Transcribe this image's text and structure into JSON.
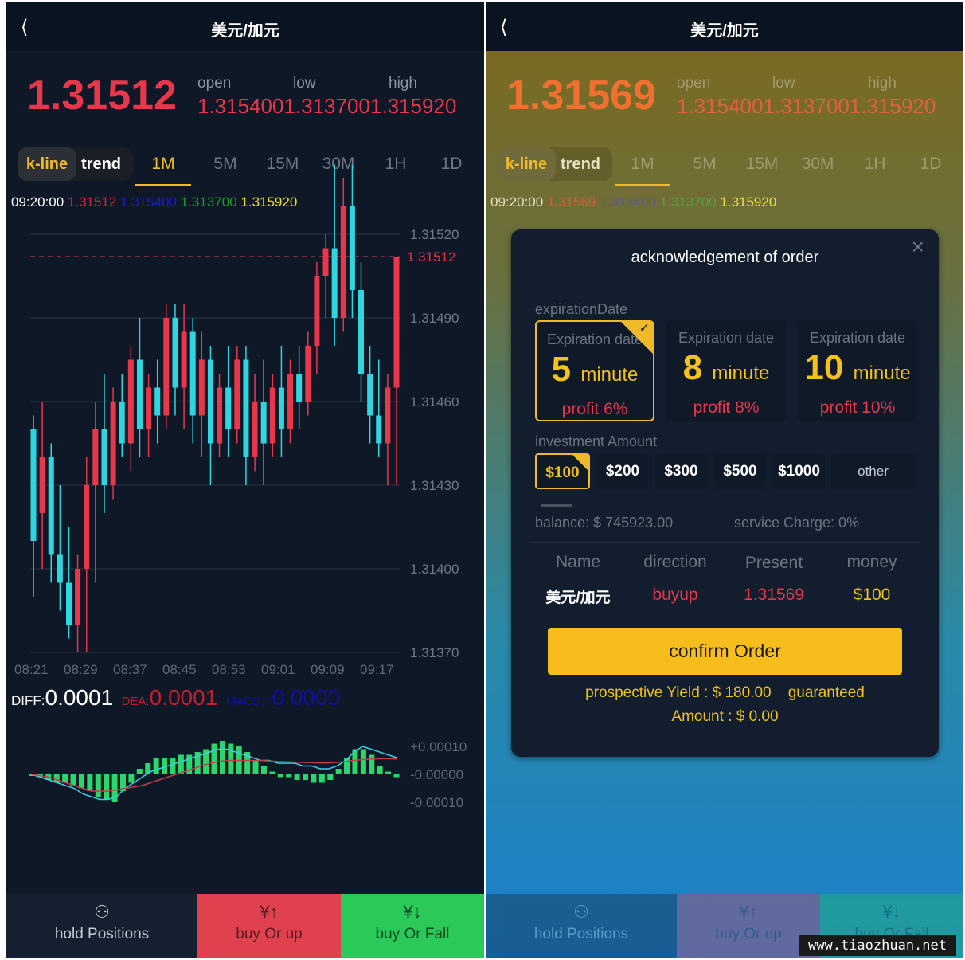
{
  "colors": {
    "up": "#e8374b",
    "down": "#2fd6e0",
    "accent": "#f0b92a",
    "buy_up": "#e0414f",
    "buy_fall": "#2bc95a",
    "macd_bar": "#2bd66a"
  },
  "left": {
    "title": "美元/加元",
    "back_icon": "chevron-left-icon",
    "price": "1.31512",
    "labels": {
      "open": "open",
      "low": "low",
      "high": "high"
    },
    "values_joined": "1.3154001.3137001.315920",
    "tabs": {
      "kline": "k-line",
      "trend": "trend",
      "timeframes": [
        "1M",
        "5M",
        "15M",
        "30M",
        "1H",
        "1D"
      ],
      "active": "1M"
    },
    "ohlc": {
      "time": "09:20:00",
      "close": "1.31512",
      "open": "1.315400",
      "low": "1.313700",
      "high": "1.315920"
    },
    "macd": {
      "diff_label": "DIFF:",
      "diff": "0.0001",
      "dea_label": "DEA:",
      "dea": "0.0001",
      "macd_label": "MACD:",
      "macd": "-0.0000"
    },
    "bottom": {
      "hold": "hold Positions",
      "up": "buy Or up",
      "fall": "buy Or Fall"
    }
  },
  "chart_data": {
    "type": "candlestick",
    "y_ticks": [
      "1.31520",
      "1.31490",
      "1.31460",
      "1.31430",
      "1.31400",
      "1.31370"
    ],
    "ylim": [
      1.3137,
      1.3152
    ],
    "current_price_label": "1.31512",
    "x_ticks": [
      "08:21",
      "08:29",
      "08:37",
      "08:45",
      "08:53",
      "09:01",
      "09:09",
      "09:17"
    ],
    "candles": [
      [
        1.3145,
        1.31455,
        1.3139,
        1.3141
      ],
      [
        1.3142,
        1.3146,
        1.314,
        1.3144
      ],
      [
        1.3144,
        1.31445,
        1.31395,
        1.31405
      ],
      [
        1.31405,
        1.3143,
        1.31385,
        1.31395
      ],
      [
        1.31395,
        1.31415,
        1.31375,
        1.3138
      ],
      [
        1.3138,
        1.31405,
        1.3137,
        1.314
      ],
      [
        1.314,
        1.3144,
        1.3137,
        1.3143
      ],
      [
        1.3143,
        1.3146,
        1.31395,
        1.3145
      ],
      [
        1.3145,
        1.3147,
        1.3142,
        1.3143
      ],
      [
        1.3143,
        1.31465,
        1.31425,
        1.3146
      ],
      [
        1.3146,
        1.3147,
        1.3144,
        1.31445
      ],
      [
        1.31445,
        1.3148,
        1.31435,
        1.31475
      ],
      [
        1.31475,
        1.3149,
        1.3144,
        1.3145
      ],
      [
        1.3145,
        1.3147,
        1.3144,
        1.31465
      ],
      [
        1.31465,
        1.31475,
        1.31445,
        1.31455
      ],
      [
        1.31455,
        1.31495,
        1.3145,
        1.3149
      ],
      [
        1.3149,
        1.31495,
        1.31455,
        1.31465
      ],
      [
        1.31465,
        1.31495,
        1.3145,
        1.31485
      ],
      [
        1.31485,
        1.3149,
        1.31445,
        1.31455
      ],
      [
        1.31455,
        1.31485,
        1.3144,
        1.31475
      ],
      [
        1.31475,
        1.3148,
        1.3143,
        1.31445
      ],
      [
        1.31445,
        1.3147,
        1.3144,
        1.31465
      ],
      [
        1.31465,
        1.3148,
        1.3144,
        1.3145
      ],
      [
        1.3145,
        1.3148,
        1.31445,
        1.31475
      ],
      [
        1.31475,
        1.3148,
        1.3143,
        1.3144
      ],
      [
        1.3144,
        1.3147,
        1.31435,
        1.3146
      ],
      [
        1.3146,
        1.31475,
        1.3143,
        1.31445
      ],
      [
        1.31445,
        1.3147,
        1.3144,
        1.31465
      ],
      [
        1.31465,
        1.3148,
        1.3144,
        1.3145
      ],
      [
        1.3145,
        1.31475,
        1.31445,
        1.3147
      ],
      [
        1.3147,
        1.3148,
        1.3145,
        1.3146
      ],
      [
        1.3146,
        1.31485,
        1.31455,
        1.3148
      ],
      [
        1.3148,
        1.3151,
        1.3147,
        1.31505
      ],
      [
        1.31505,
        1.3152,
        1.3149,
        1.31515
      ],
      [
        1.31515,
        1.31545,
        1.3148,
        1.3149
      ],
      [
        1.3149,
        1.3154,
        1.31485,
        1.3153
      ],
      [
        1.3153,
        1.31545,
        1.3149,
        1.315
      ],
      [
        1.315,
        1.3151,
        1.3146,
        1.3147
      ],
      [
        1.3147,
        1.3148,
        1.31445,
        1.31455
      ],
      [
        1.31455,
        1.31475,
        1.3144,
        1.31445
      ],
      [
        1.31445,
        1.3147,
        1.3143,
        1.31465
      ],
      [
        1.31465,
        1.31512,
        1.3143,
        1.31512
      ]
    ],
    "macd_ticks": [
      "+0.00010",
      "-0.00000",
      "-0.00010"
    ],
    "macd_hist": [
      0,
      -1,
      -2,
      -3,
      -3,
      -4,
      -5,
      -6,
      -8,
      -9,
      -10,
      -6,
      -3,
      2,
      4,
      6,
      6,
      6,
      7,
      7,
      8,
      9,
      11,
      12,
      11,
      10,
      8,
      5,
      3,
      1,
      -1,
      -1,
      -2,
      -2,
      -3,
      -3,
      -2,
      2,
      6,
      9,
      9,
      7,
      3,
      1,
      -1
    ],
    "diff_line": [
      0,
      -1,
      -2,
      -3,
      -4,
      -5,
      -7,
      -8,
      -9,
      -9,
      -8,
      -5,
      -3,
      -1,
      1,
      2,
      3,
      4,
      5,
      6,
      7,
      8,
      9,
      9,
      8,
      7,
      6,
      5,
      5,
      4,
      4,
      4,
      3,
      3,
      2,
      2,
      3,
      5,
      8,
      10,
      9,
      8,
      7,
      6
    ],
    "dea_line": [
      0,
      -0.5,
      -1,
      -2,
      -3,
      -4,
      -5,
      -6,
      -6,
      -6,
      -5.5,
      -5,
      -4.5,
      -4,
      -3,
      -2,
      -1,
      0,
      1,
      2,
      3,
      4,
      4.5,
      5,
      5,
      5,
      5,
      5,
      4.8,
      4.6,
      4.5,
      4.4,
      4.3,
      4.2,
      4.1,
      4.1,
      4.3,
      4.6,
      5,
      5.3,
      5.5,
      5.6,
      5.6,
      5.5
    ]
  },
  "right": {
    "title": "美元/加元",
    "price": "1.31569",
    "ohlc_close": "1.31569",
    "modal": {
      "title": "acknowledgement of order",
      "close_icon": "close-icon",
      "expiration_label": "expirationDate",
      "options": [
        {
          "label": "Expiration date",
          "num": "5",
          "unit": "minute",
          "profit": "profit 6%",
          "selected": true
        },
        {
          "label": "Expiration date",
          "num": "8",
          "unit": "minute",
          "profit": "profit 8%",
          "selected": false
        },
        {
          "label": "Expiration date",
          "num": "10",
          "unit": "minute",
          "profit": "profit 10%",
          "selected": false
        }
      ],
      "investment_label": "investment Amount",
      "amounts": [
        "$100",
        "$200",
        "$300",
        "$500",
        "$1000",
        "other"
      ],
      "selected_amount": "$100",
      "balance": "balance: $ 745923.00",
      "service_charge": "service Charge:  0%",
      "columns": [
        "Name",
        "direction",
        "Present price",
        "money"
      ],
      "row": [
        "美元/加元",
        "buyup",
        "1.31569",
        "$100"
      ],
      "confirm": "confirm Order",
      "yield_line1": "prospective Yield : $ 180.00    guaranteed",
      "yield_line2": "Amount : $ 0.00"
    }
  },
  "watermark": "www.tiaozhuan.net"
}
